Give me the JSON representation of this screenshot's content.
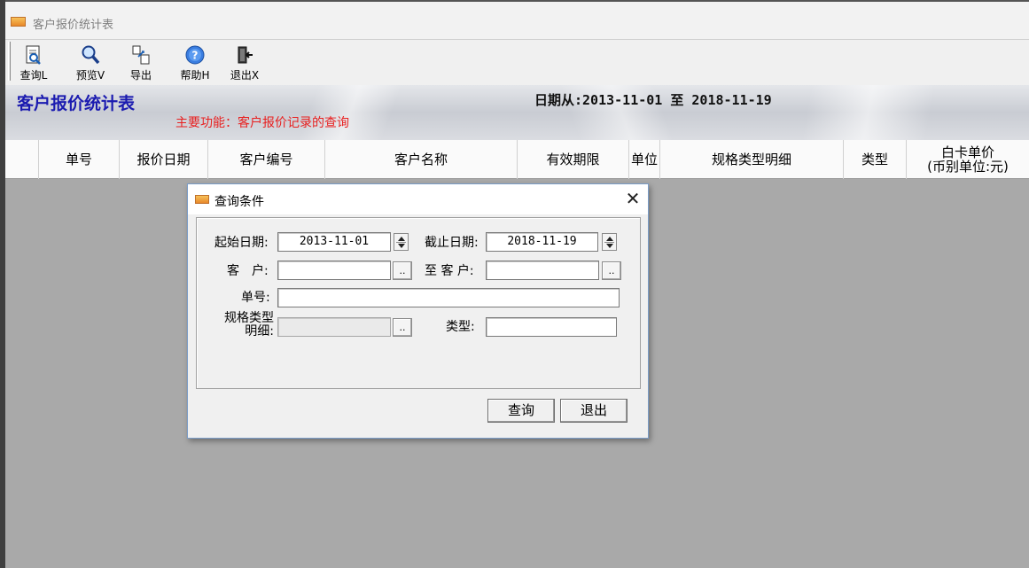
{
  "window": {
    "title": "客户报价统计表"
  },
  "toolbar": {
    "items": [
      {
        "label": "查询L",
        "icon": "query-doc-icon"
      },
      {
        "label": "预览V",
        "icon": "magnifier-icon"
      },
      {
        "label": "导出",
        "icon": "export-icon"
      },
      {
        "label": "帮助H",
        "icon": "help-icon"
      },
      {
        "label": "退出X",
        "icon": "exit-door-icon"
      }
    ]
  },
  "banner": {
    "title": "客户报价统计表",
    "function_text": "主要功能：客户报价记录的查询",
    "date_range": "日期从:2013-11-01 至 2018-11-19"
  },
  "grid": {
    "columns": [
      "单号",
      "报价日期",
      "客户编号",
      "客户名称",
      "有效期限",
      "单位",
      "规格类型明细",
      "类型",
      "白卡单价\n(币别单位:元)"
    ]
  },
  "dialog": {
    "title": "查询条件",
    "close_glyph": "✕",
    "start_date_label": "起始日期:",
    "start_date": "2013-11-01",
    "end_date_label": "截止日期:",
    "end_date": "2018-11-19",
    "customer_label": "客　户:",
    "customer_value": "",
    "to_customer_label": "至 客 户:",
    "to_customer_value": "",
    "order_no_label": "单号:",
    "order_no_value": "",
    "spec_label": "规格类型明细:",
    "spec_value": "",
    "type_label": "类型:",
    "type_value": "",
    "browse_glyph": "..",
    "query_button": "查询",
    "exit_button": "退出"
  },
  "colors": {
    "title_blue": "#1b1bb0",
    "function_red": "#e82020",
    "grid_background": "#a9a9a9"
  }
}
